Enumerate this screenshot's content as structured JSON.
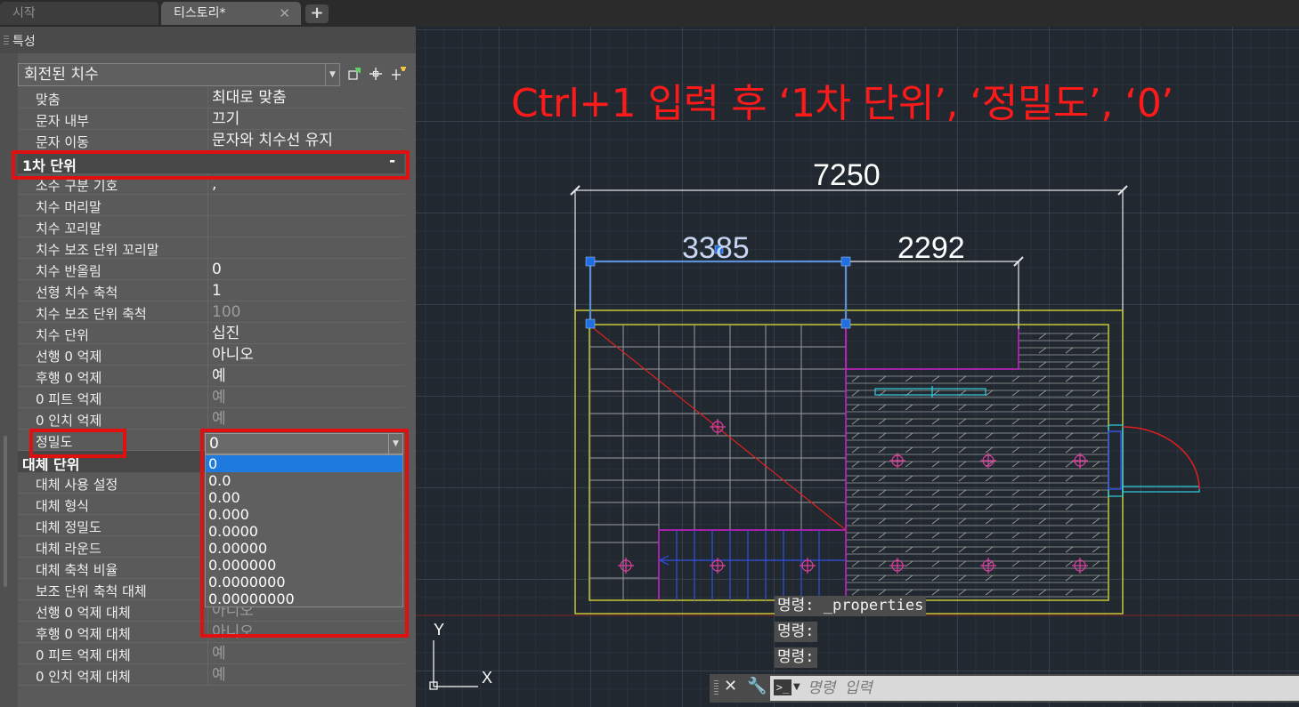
{
  "tabs": [
    {
      "label": "시작",
      "active": false
    },
    {
      "label": "티스토리*",
      "active": true
    }
  ],
  "tab_close_glyph": "✕",
  "tab_add_glyph": "+",
  "palette": {
    "title": "특성",
    "object_type": "회전된 치수",
    "tool_icons": [
      "quick-select-icon",
      "select-objects-icon",
      "toggle-pickadd-icon"
    ]
  },
  "properties": {
    "fit_rows": [
      {
        "label": "맞춤",
        "value": "최대로 맞춤"
      },
      {
        "label": "문자 내부",
        "value": "끄기"
      },
      {
        "label": "문자 이동",
        "value": "문자와 치수선 유지"
      }
    ],
    "primary_units": {
      "title": "1차 단위",
      "toggle": "-",
      "rows": [
        {
          "label": "소수 구분 기호",
          "value": ",",
          "disabled": false
        },
        {
          "label": "치수 머리말",
          "value": "",
          "disabled": false
        },
        {
          "label": "치수 꼬리말",
          "value": "",
          "disabled": false
        },
        {
          "label": "치수 보조 단위 꼬리말",
          "value": "",
          "disabled": false
        },
        {
          "label": "치수 반올림",
          "value": "0",
          "disabled": false
        },
        {
          "label": "선형 치수 축척",
          "value": "1",
          "disabled": false
        },
        {
          "label": "치수 보조 단위 축척",
          "value": "100",
          "disabled": true
        },
        {
          "label": "치수 단위",
          "value": "십진",
          "disabled": false
        },
        {
          "label": "선행 0 억제",
          "value": "아니오",
          "disabled": false
        },
        {
          "label": "후행 0 억제",
          "value": "예",
          "disabled": false
        },
        {
          "label": "0 피트 억제",
          "value": "예",
          "disabled": true
        },
        {
          "label": "0 인치 억제",
          "value": "예",
          "disabled": true
        }
      ],
      "precision": {
        "label": "정밀도",
        "value": "0",
        "options": [
          "0",
          "0.0",
          "0.00",
          "0.000",
          "0.0000",
          "0.00000",
          "0.000000",
          "0.0000000",
          "0.00000000"
        ],
        "selected_index": 0
      }
    },
    "alternate_units": {
      "title": "대체 단위",
      "rows": [
        {
          "label": "대체 사용 설정",
          "value": "",
          "disabled": false
        },
        {
          "label": "대체 형식",
          "value": "",
          "disabled": false
        },
        {
          "label": "대체 정밀도",
          "value": "",
          "disabled": false
        },
        {
          "label": "대체 라운드",
          "value": "",
          "disabled": false
        },
        {
          "label": "대체 축척 비율",
          "value": "",
          "disabled": false
        },
        {
          "label": "보조 단위 축척 대체",
          "value": "",
          "disabled": false
        },
        {
          "label": "선행 0 억제 대체",
          "value": "아니오",
          "disabled": true
        },
        {
          "label": "후행 0 억제 대체",
          "value": "아니오",
          "disabled": true
        },
        {
          "label": "0 피트 억제 대체",
          "value": "예",
          "disabled": true
        },
        {
          "label": "0 인치 억제 대체",
          "value": "예",
          "disabled": true
        }
      ]
    }
  },
  "annotation": "Ctrl+1 입력 후 ‘1차 단위’, ‘정밀도’, ‘0’",
  "dimensions": {
    "overall": "7250",
    "left": "3385",
    "right": "2292"
  },
  "command_history": [
    "명령: _properties",
    "명령:",
    "명령:"
  ],
  "command_line": {
    "placeholder": "명령 입력",
    "prompt_glyph": ">_"
  },
  "ucs": {
    "x": "X",
    "y": "Y"
  },
  "colors": {
    "annotation_red": "#e01010",
    "selection_blue": "#1e7adf",
    "wall_yellow": "#c8c838",
    "dimension_white": "#ffffff",
    "selected_dim_blue": "#5b8fd8",
    "magenta": "#d020d0",
    "hatch_gray": "#a0a0a0"
  }
}
